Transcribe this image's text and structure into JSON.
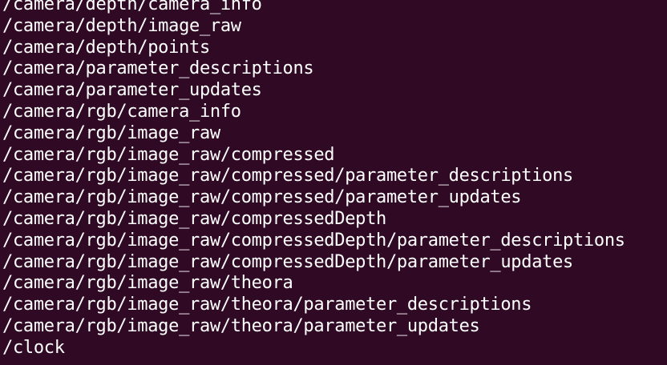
{
  "terminal": {
    "lines": [
      "/camera/depth/camera_info",
      "/camera/depth/image_raw",
      "/camera/depth/points",
      "/camera/parameter_descriptions",
      "/camera/parameter_updates",
      "/camera/rgb/camera_info",
      "/camera/rgb/image_raw",
      "/camera/rgb/image_raw/compressed",
      "/camera/rgb/image_raw/compressed/parameter_descriptions",
      "/camera/rgb/image_raw/compressed/parameter_updates",
      "/camera/rgb/image_raw/compressedDepth",
      "/camera/rgb/image_raw/compressedDepth/parameter_descriptions",
      "/camera/rgb/image_raw/compressedDepth/parameter_updates",
      "/camera/rgb/image_raw/theora",
      "/camera/rgb/image_raw/theora/parameter_descriptions",
      "/camera/rgb/image_raw/theora/parameter_updates",
      "/clock"
    ]
  },
  "colors": {
    "background": "#300a24",
    "text": "#ffffff"
  }
}
